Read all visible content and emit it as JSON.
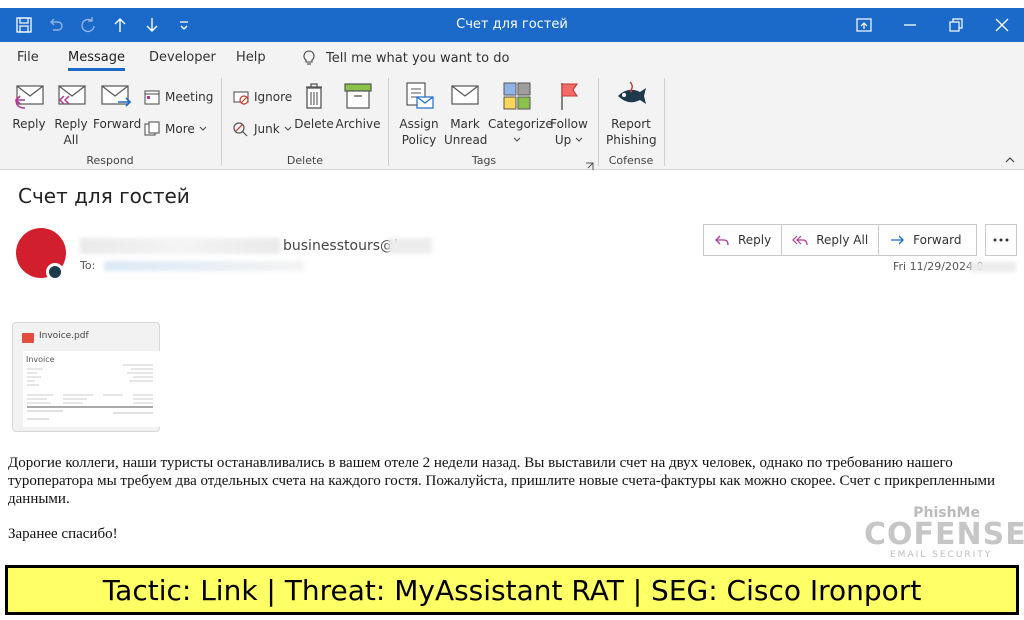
{
  "window": {
    "title": "Счет для гостей"
  },
  "menu": {
    "tabs": [
      "File",
      "Message",
      "Developer",
      "Help"
    ],
    "tell_me": "Tell me what you want to do"
  },
  "ribbon": {
    "respond": {
      "label": "Respond",
      "reply": "Reply",
      "reply_all_1": "Reply",
      "reply_all_2": "All",
      "forward": "Forward",
      "meeting": "Meeting",
      "more": "More"
    },
    "delete": {
      "label": "Delete",
      "ignore": "Ignore",
      "junk": "Junk",
      "delete": "Delete",
      "archive": "Archive"
    },
    "tags": {
      "label": "Tags",
      "assign_1": "Assign",
      "assign_2": "Policy",
      "mark_1": "Mark",
      "mark_2": "Unread",
      "categorize": "Categorize",
      "follow_1": "Follow",
      "follow_2": "Up"
    },
    "cofense": {
      "label": "Cofense",
      "report_1": "Report",
      "report_2": "Phishing"
    }
  },
  "message": {
    "subject": "Счет для гостей",
    "sender_visible": "businesstours@b",
    "to_label": "To:",
    "date": "Fri 11/29/2024 0",
    "actions": {
      "reply": "Reply",
      "reply_all": "Reply All",
      "forward": "Forward"
    },
    "attachment": {
      "filename": "Invoice.pdf",
      "preview_title": "Invoice"
    },
    "body": "Дорогие коллеги, наши туристы останавливались в вашем отеле 2 недели назад. Вы выставили счет на двух человек, однако по требованию нашего туроператора мы требуем два отдельных счета на каждого гостя. Пожалуйста, пришлите новые счета-фактуры как можно скорее.  Счет с прикрепленными данными.",
    "thanks": "Заранее спасибо!"
  },
  "logo": {
    "top": "PhishMe",
    "main": "COFENSE",
    "sub": "EMAIL SECURITY"
  },
  "banner": {
    "text": "Tactic: Link | Threat: MyAssistant RAT | SEG: Cisco Ironport"
  },
  "colors": {
    "titlebar": "#1b6ac9",
    "avatar": "#d21f2e",
    "banner_bg": "#ffff66"
  }
}
